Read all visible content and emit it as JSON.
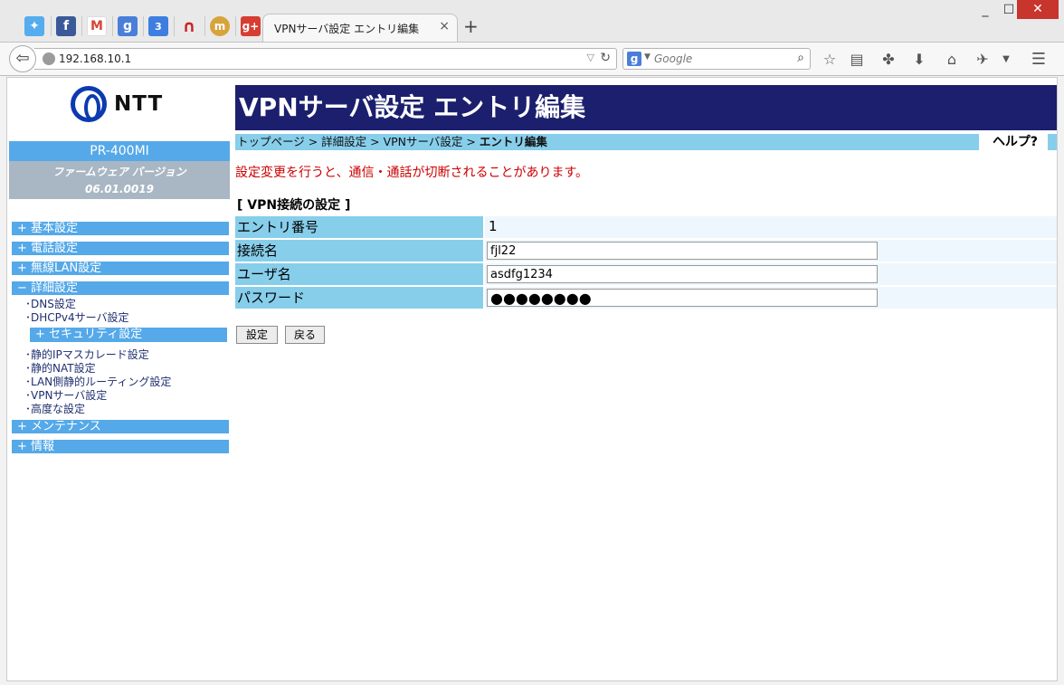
{
  "browser": {
    "tab_title": "VPNサーバ設定 エントリ編集",
    "tab_close": "×",
    "new_tab": "+",
    "url": "192.168.10.1",
    "search_placeholder": "Google",
    "win_min": "_",
    "win_max": "☐",
    "win_close": "✕",
    "pinned_tabs": [
      {
        "icon": "twitter-icon",
        "glyph": "✦",
        "color": "#55acee"
      },
      {
        "icon": "facebook-icon",
        "glyph": "f",
        "color": "#3b5998"
      },
      {
        "icon": "gmail-icon",
        "glyph": "M",
        "color": "#d44638"
      },
      {
        "icon": "google-icon",
        "glyph": "g",
        "color": "#4a7fd9"
      },
      {
        "icon": "calendar-icon",
        "glyph": "3",
        "color": "#3d7ee0"
      },
      {
        "icon": "arc-icon",
        "glyph": "∩",
        "color": "#cc2222"
      },
      {
        "icon": "mixi-icon",
        "glyph": "m",
        "color": "#d7a33b"
      },
      {
        "icon": "google-plus-icon",
        "glyph": "g+",
        "color": "#d73d32"
      }
    ]
  },
  "sidebar": {
    "logo_text": "NTT",
    "model": "PR-400MI",
    "firmware_label": "ファームウェア バージョン",
    "firmware_version": "06.01.0019",
    "menu": {
      "basic": "+ 基本設定",
      "phone": "+ 電話設定",
      "wlan": "+ 無線LAN設定",
      "advanced": "− 詳細設定",
      "dns": "･DNS設定",
      "dhcp": "･DHCPv4サーバ設定",
      "security": "+ セキュリティ設定",
      "masq": "･静的IPマスカレード設定",
      "nat": "･静的NAT設定",
      "routing": "･LAN側静的ルーティング設定",
      "vpn": "･VPNサーバ設定",
      "adv": "･高度な設定",
      "maintenance": "+ メンテナンス",
      "info": "+ 情報"
    }
  },
  "main": {
    "heading": "VPNサーバ設定 エントリ編集",
    "breadcrumb": {
      "path": "トップページ > 詳細設定 > VPNサーバ設定 > ",
      "current": "エントリ編集"
    },
    "help": "ヘルプ?",
    "warning": "設定変更を行うと、通信・通話が切断されることがあります。",
    "section_title": "[ VPN接続の設定 ]",
    "rows": {
      "entry_no_label": "エントリ番号",
      "entry_no_value": "1",
      "conn_label": "接続名",
      "conn_value": "fjl22",
      "user_label": "ユーザ名",
      "user_value": "asdfg1234",
      "pass_label": "パスワード",
      "pass_value": "●●●●●●●●"
    },
    "buttons": {
      "set": "設定",
      "back": "戻る"
    }
  }
}
